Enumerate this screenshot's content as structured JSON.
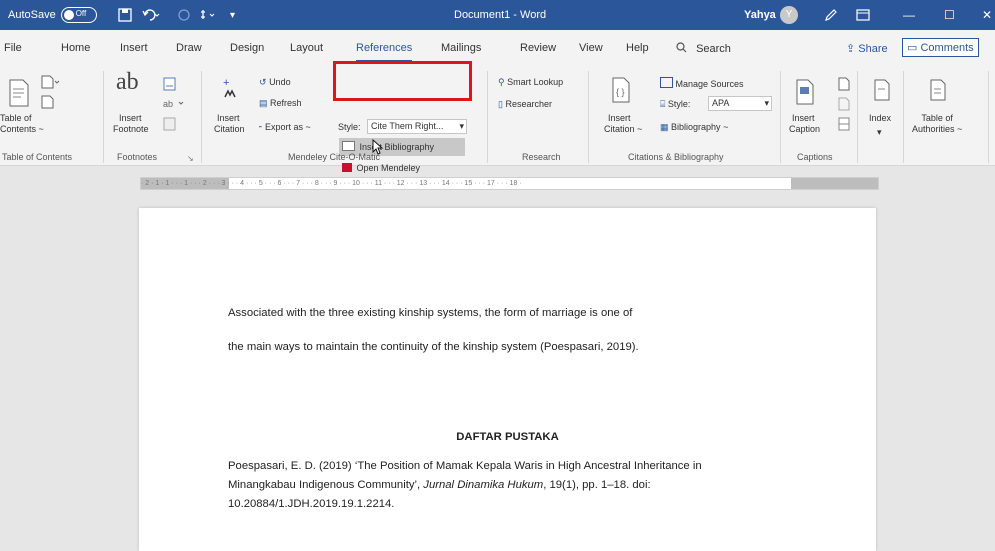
{
  "titlebar": {
    "autosave_label": "AutoSave",
    "autosave_state": "Off",
    "document_title": "Document1 - Word",
    "user_name": "Yahya",
    "user_initial": "Y",
    "minimize": "—",
    "restore": "☐",
    "close": "✕"
  },
  "tabs": [
    "File",
    "Home",
    "Insert",
    "Draw",
    "Design",
    "Layout",
    "References",
    "Mailings",
    "Review",
    "View",
    "Help"
  ],
  "search_label": "Search",
  "share_label": "Share",
  "comments_label": "Comments",
  "ribbon": {
    "toc": {
      "line1": "Table of",
      "line2": "Contents ~",
      "group": "Table of Contents"
    },
    "footnotes": {
      "ab": "ab",
      "line1": "Insert",
      "line2": "Footnote",
      "group": "Footnotes"
    },
    "mendeley": {
      "undo": "Undo",
      "refresh": "Refresh",
      "insert_citation_1": "Insert",
      "insert_citation_2": "Citation",
      "insert_bibliography": "Insert Bibliography",
      "open_mendeley": "Open Mendeley",
      "export_as": "Export as ~",
      "style_label": "Style:",
      "style_value": "Cite Them Right...",
      "group": "Mendeley Cite-O-Matic"
    },
    "research": {
      "smart_lookup": "Smart Lookup",
      "researcher": "Researcher",
      "group": "Research"
    },
    "citations": {
      "insert_1": "Insert",
      "insert_2": "Citation ~",
      "manage_sources": "Manage Sources",
      "style_label": "Style:",
      "style_value": "APA",
      "bibliography": "Bibliography ~",
      "group": "Citations & Bibliography"
    },
    "captions": {
      "line1": "Insert",
      "line2": "Caption",
      "group": "Captions"
    },
    "index": {
      "label": "Index"
    },
    "authorities": {
      "line1": "Table of",
      "line2": "Authorities ~"
    }
  },
  "ruler_text": "· 2 · 1 · 1 · · · 1 · · · 2 · · · 3 · · · 4 · · · 5 · · · 6 · · · 7 · · · 8 · · · 9 · · · 10 · · · 11 · · · 12 · · · 13 · · · 14 · · · 15 · · · 17 · · · 18 ·",
  "document": {
    "para_line1": "Associated with the three existing kinship systems, the form of marriage is one of",
    "para_line2": "the main ways to maintain the continuity of the kinship system (Poespasari, 2019).",
    "heading": "DAFTAR PUSTAKA",
    "ref_line1": "Poespasari, E. D. (2019) ‘The Position of Mamak Kepala Waris in High Ancestral Inheritance in",
    "ref_line2_pre": "Minangkabau Indigenous Community’, ",
    "ref_line2_journal": "Jurnal Dinamika Hukum",
    "ref_line2_post": ", 19(1), pp. 1–18. doi:",
    "ref_line3": "10.20884/1.JDH.2019.19.1.2214."
  },
  "colors": {
    "accent": "#2b579a",
    "highlight": "#e01616",
    "mendeley_red": "#c8102e"
  }
}
